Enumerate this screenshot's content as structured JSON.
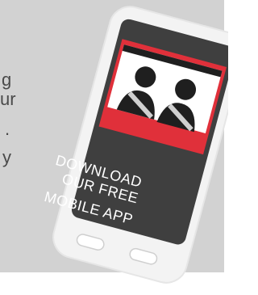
{
  "side_text": {
    "line1": "g",
    "line2": "ur",
    "line3": ".",
    "line4": "y"
  },
  "promo": {
    "line1": "DOWNLOAD",
    "line2": "OUR FREE",
    "line3": "MOBILE APP"
  },
  "icons": {
    "illustration": "two-people-seatbelt-icon"
  },
  "colors": {
    "background": "#d2d2d2",
    "phone_body": "#f3f3f3",
    "screen": "#3f3f3f",
    "accent_red": "#e0303a",
    "illustration_dark": "#1f1f1f"
  }
}
